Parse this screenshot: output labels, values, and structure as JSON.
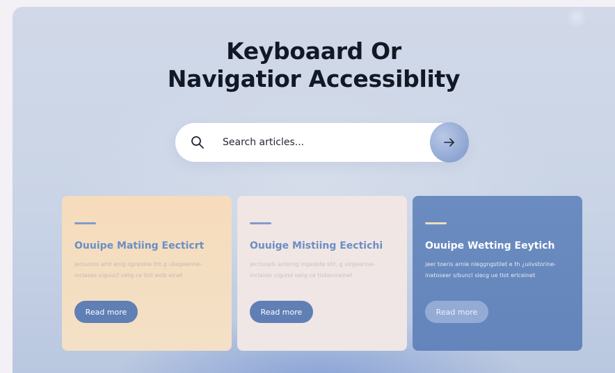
{
  "hero": {
    "title_line1": "Keyboaard Or",
    "title_line2": "Navigatior Accessiblity"
  },
  "search": {
    "placeholder": "Search articles...",
    "search_icon": "search-icon",
    "submit_icon": "arrow-right-icon"
  },
  "cards": [
    {
      "title": "Ouuipe Matiing Eecticrt",
      "desc_line1": "jecluonis amt enig ligcesble tht g ullegeerine-",
      "desc_line2": "inclases s/guuct selig ce tlot evlb einet",
      "button": "Read more"
    },
    {
      "title": "Ouuige Mistiing Eectichi",
      "desc_line1": "jecriusels antenig ingedete sht, g ulrgearine-",
      "desc_line2": "inclases s/gund selig ce tlotenlceinet",
      "button": "Read more"
    },
    {
      "title": "Ouuipe Wetting Eeytich",
      "desc_line1": "jeer toeris arnle nleggngstilet e th ¿uiivstorine-",
      "desc_line2": "inatoseer s/buncl slecg ue tlot erlceinet",
      "button": "Read more"
    }
  ],
  "colors": {
    "accent_blue": "#5f7fb5",
    "card_peach": "#f6dcbc",
    "card_blush": "#f1e6e3",
    "card_blue": "#6a8cc0"
  }
}
